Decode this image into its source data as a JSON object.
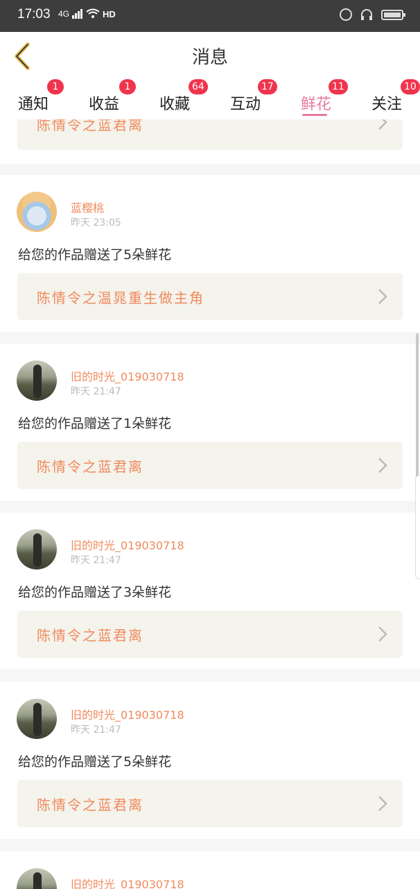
{
  "status_bar": {
    "time": "17:03",
    "network": "4G",
    "hd": "HD",
    "icons": [
      "signal-icon",
      "wifi-icon",
      "hd-icon",
      "lock-rotation-icon",
      "headphones-icon",
      "battery-icon"
    ]
  },
  "header": {
    "title": "消息",
    "back_icon": "back-chevron-icon"
  },
  "tabs": [
    {
      "label": "通知",
      "badge": "1"
    },
    {
      "label": "收益",
      "badge": "1"
    },
    {
      "label": "收藏",
      "badge": "64"
    },
    {
      "label": "互动",
      "badge": "17"
    },
    {
      "label": "鲜花",
      "badge": "11",
      "active": true
    },
    {
      "label": "关注",
      "badge": "10"
    }
  ],
  "colors": {
    "accent_pink": "#e87aa3",
    "badge_red": "#f0344d",
    "username_orange": "#f08a5d",
    "work_box_bg": "#f4f3ec"
  },
  "feed": {
    "partial_top_work": "陈情令之蓝君离",
    "items": [
      {
        "username": "蓝樱桃",
        "time": "昨天  23:05",
        "message": "给您的作品赠送了5朵鲜花",
        "work": "陈情令之温晁重生做主角",
        "avatar": "anime-avatar"
      },
      {
        "username": "旧的时光_01903071​8",
        "time": "昨天  21:47",
        "message": "给您的作品赠送了1朵鲜花",
        "work": "陈情令之蓝君离",
        "avatar": "photo-avatar"
      },
      {
        "username": "旧的时光_01903071​8",
        "time": "昨天  21:47",
        "message": "给您的作品赠送了3朵鲜花",
        "work": "陈情令之蓝君离",
        "avatar": "photo-avatar"
      },
      {
        "username": "旧的时光_01903071​8",
        "time": "昨天  21:47",
        "message": "给您的作品赠送了5朵鲜花",
        "work": "陈情令之蓝君离",
        "avatar": "photo-avatar"
      },
      {
        "username": "旧的时光_01903071​8",
        "avatar": "photo-avatar"
      }
    ]
  }
}
